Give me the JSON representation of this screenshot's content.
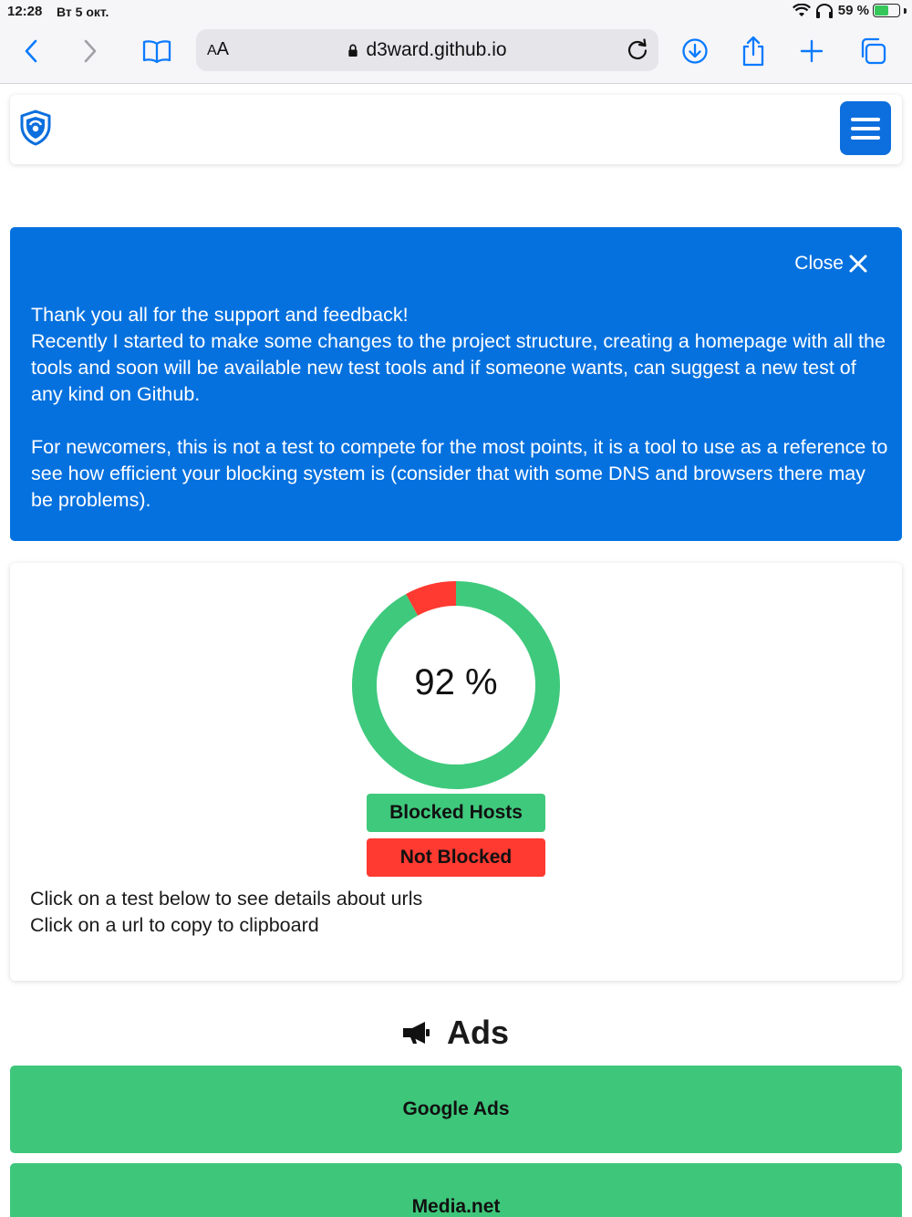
{
  "status_bar": {
    "time": "12:28",
    "date": "Вт 5 окт.",
    "battery": "59 %",
    "battery_level": 0.59
  },
  "browser": {
    "text_size_label_small": "A",
    "text_size_label": "A",
    "url": "d3ward.github.io"
  },
  "alert": {
    "close_label": "Close",
    "paragraph1": "Thank you all for the support and feedback!\nRecently I started to make some changes to the project structure, creating a homepage with all the tools and soon will be available new test tools and if someone wants, can suggest a new test of any kind on Github.",
    "paragraph2": "For newcomers, this is not a test to compete for the most points, it is a tool to use as a reference to see how efficient your blocking system is (consider that with some DNS and browsers there may be problems)."
  },
  "results": {
    "score_label": "92 %",
    "score_percent": 92,
    "legend_blocked": "Blocked Hosts",
    "legend_not_blocked": "Not Blocked",
    "hint1": "Click on a test below to see details about urls",
    "hint2": "Click on a url to copy to clipboard"
  },
  "colors": {
    "blocked": "#3fc97d",
    "not_blocked": "#fe3a31",
    "brand_blue": "#0571df"
  },
  "section": {
    "icon": "megaphone-icon",
    "title": "Ads",
    "tests": [
      "Google Ads",
      "Media.net"
    ]
  }
}
